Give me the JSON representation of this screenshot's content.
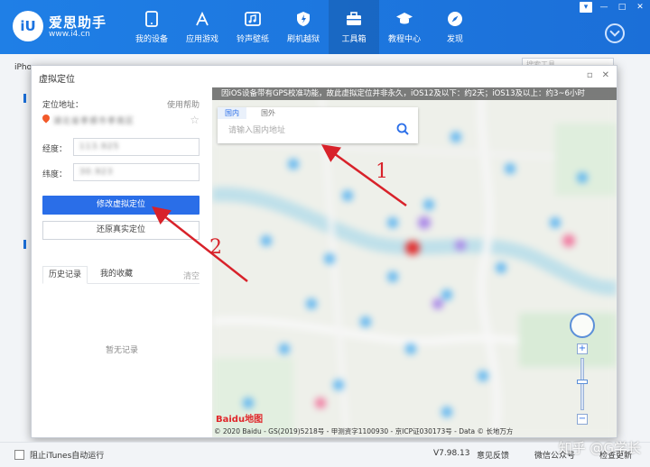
{
  "app": {
    "name": "爱思助手",
    "url": "www.i4.cn",
    "logo_text": "iU"
  },
  "nav": [
    {
      "label": "我的设备",
      "icon": "phone-icon"
    },
    {
      "label": "应用游戏",
      "icon": "apps-icon"
    },
    {
      "label": "铃声壁纸",
      "icon": "music-icon"
    },
    {
      "label": "刷机越狱",
      "icon": "flash-icon"
    },
    {
      "label": "工具箱",
      "icon": "toolbox-icon",
      "active": true
    },
    {
      "label": "教程中心",
      "icon": "graduation-cap-icon"
    },
    {
      "label": "发现",
      "icon": "compass-icon"
    }
  ],
  "background": {
    "device_tab": "iPho",
    "search_placeholder": "搜索工具"
  },
  "dialog": {
    "title": "虚拟定位",
    "location_label": "定位地址：",
    "help_link": "使用帮助",
    "location_value": "湖北省孝感市孝南区",
    "longitude_label": "经度：",
    "longitude_value": "113.925",
    "latitude_label": "纬度：",
    "latitude_value": "30.923",
    "modify_button": "修改虚拟定位",
    "restore_button": "还原真实定位",
    "tab_history": "历史记录",
    "tab_favorites": "我的收藏",
    "clear": "清空",
    "empty": "暂无记录"
  },
  "map": {
    "notice": "因iOS设备带有GPS校准功能，故此虚拟定位并非永久，iOS12及以下：约2天；iOS13及以上：约3~6小时",
    "tab_domestic": "国内",
    "tab_foreign": "国外",
    "search_placeholder": "请输入国内地址",
    "copyright": "© 2020 Baidu - GS(2019)5218号 - 甲测资字1100930 - 京ICP证030173号 - Data © 长地万方",
    "baidu_logo": "Baidu地图"
  },
  "footer": {
    "itunes_checkbox": "阻止iTunes自动运行",
    "version": "V7.98.13",
    "feedback": "意见反馈",
    "wechat": "微信公众号",
    "update": "检查更新"
  },
  "annotations": {
    "arrow1": "1",
    "arrow2": "2"
  },
  "watermark": "知乎 @G学长",
  "colors": {
    "header": "#1b6fd8",
    "primary_button": "#2a6ee8",
    "annotation": "#d8222a"
  }
}
